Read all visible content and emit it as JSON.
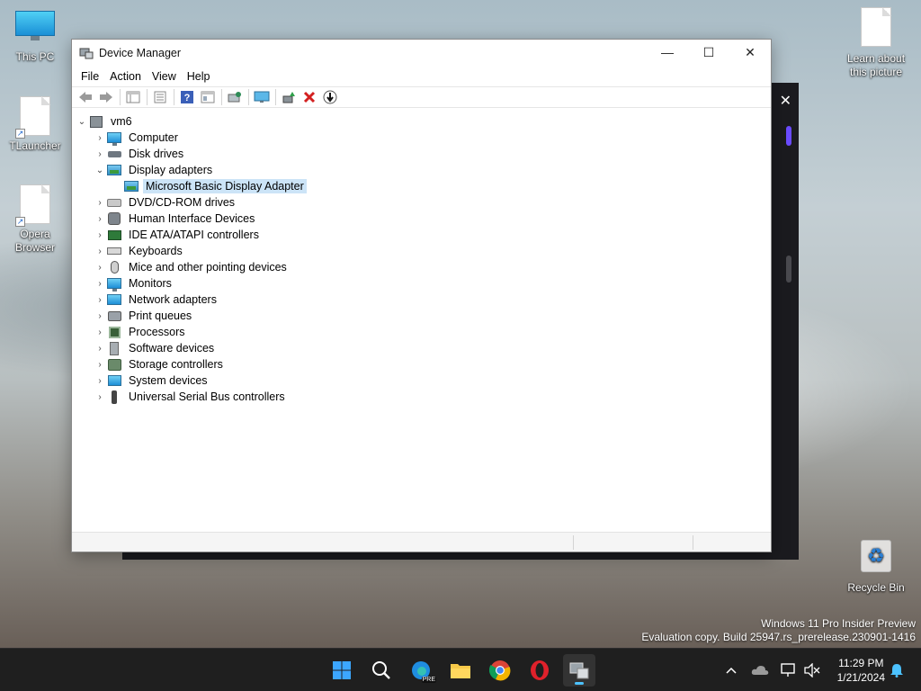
{
  "desktop": {
    "icons": [
      {
        "label": "This PC"
      },
      {
        "label": "TLauncher"
      },
      {
        "label": "Opera Browser"
      },
      {
        "label": "Learn about this picture"
      },
      {
        "label": "Recycle Bin"
      }
    ],
    "watermark": {
      "line1": "Windows 11 Pro Insider Preview",
      "line2": "Evaluation copy. Build 25947.rs_prerelease.230901-1416"
    }
  },
  "window": {
    "title": "Device Manager",
    "controls": {
      "minimize": "—",
      "maximize": "☐",
      "close": "✕"
    },
    "menu": [
      "File",
      "Action",
      "View",
      "Help"
    ],
    "toolbar_icons": [
      "back-icon",
      "forward-icon",
      "show-hide-tree-icon",
      "properties-icon",
      "help-icon",
      "view-icon",
      "scan-hardware-icon",
      "monitor-icon",
      "update-driver-icon",
      "uninstall-icon",
      "disable-icon"
    ]
  },
  "tree": {
    "root": "vm6",
    "nodes": [
      {
        "label": "Computer",
        "icon": "computer-icon",
        "expanded": false
      },
      {
        "label": "Disk drives",
        "icon": "disk-drive-icon",
        "expanded": false
      },
      {
        "label": "Display adapters",
        "icon": "display-adapter-icon",
        "expanded": true,
        "children": [
          {
            "label": "Microsoft Basic Display Adapter",
            "selected": true
          }
        ]
      },
      {
        "label": "DVD/CD-ROM drives",
        "icon": "dvd-icon",
        "expanded": false
      },
      {
        "label": "Human Interface Devices",
        "icon": "hid-icon",
        "expanded": false
      },
      {
        "label": "IDE ATA/ATAPI controllers",
        "icon": "ide-icon",
        "expanded": false
      },
      {
        "label": "Keyboards",
        "icon": "keyboard-icon",
        "expanded": false
      },
      {
        "label": "Mice and other pointing devices",
        "icon": "mouse-icon",
        "expanded": false
      },
      {
        "label": "Monitors",
        "icon": "monitor-icon",
        "expanded": false
      },
      {
        "label": "Network adapters",
        "icon": "network-adapter-icon",
        "expanded": false
      },
      {
        "label": "Print queues",
        "icon": "printer-icon",
        "expanded": false
      },
      {
        "label": "Processors",
        "icon": "processor-icon",
        "expanded": false
      },
      {
        "label": "Software devices",
        "icon": "software-device-icon",
        "expanded": false
      },
      {
        "label": "Storage controllers",
        "icon": "storage-controller-icon",
        "expanded": false
      },
      {
        "label": "System devices",
        "icon": "system-device-icon",
        "expanded": false
      },
      {
        "label": "Universal Serial Bus controllers",
        "icon": "usb-icon",
        "expanded": false
      }
    ]
  },
  "taskbar": {
    "apps": [
      "start-icon",
      "search-icon",
      "edge-icon",
      "file-explorer-icon",
      "chrome-icon",
      "opera-icon",
      "device-manager-icon"
    ],
    "edge_badge": "PRE",
    "clock": {
      "time": "11:29 PM",
      "date": "1/21/2024"
    }
  }
}
